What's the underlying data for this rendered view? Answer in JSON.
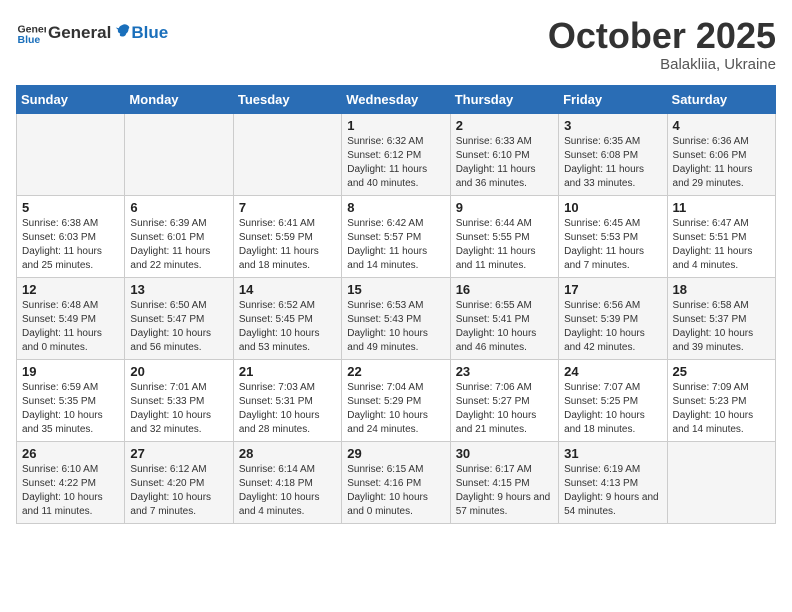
{
  "header": {
    "logo_general": "General",
    "logo_blue": "Blue",
    "month_title": "October 2025",
    "location": "Balakliia, Ukraine"
  },
  "weekdays": [
    "Sunday",
    "Monday",
    "Tuesday",
    "Wednesday",
    "Thursday",
    "Friday",
    "Saturday"
  ],
  "weeks": [
    [
      {
        "day": "",
        "text": ""
      },
      {
        "day": "",
        "text": ""
      },
      {
        "day": "",
        "text": ""
      },
      {
        "day": "1",
        "text": "Sunrise: 6:32 AM\nSunset: 6:12 PM\nDaylight: 11 hours\nand 40 minutes."
      },
      {
        "day": "2",
        "text": "Sunrise: 6:33 AM\nSunset: 6:10 PM\nDaylight: 11 hours\nand 36 minutes."
      },
      {
        "day": "3",
        "text": "Sunrise: 6:35 AM\nSunset: 6:08 PM\nDaylight: 11 hours\nand 33 minutes."
      },
      {
        "day": "4",
        "text": "Sunrise: 6:36 AM\nSunset: 6:06 PM\nDaylight: 11 hours\nand 29 minutes."
      }
    ],
    [
      {
        "day": "5",
        "text": "Sunrise: 6:38 AM\nSunset: 6:03 PM\nDaylight: 11 hours\nand 25 minutes."
      },
      {
        "day": "6",
        "text": "Sunrise: 6:39 AM\nSunset: 6:01 PM\nDaylight: 11 hours\nand 22 minutes."
      },
      {
        "day": "7",
        "text": "Sunrise: 6:41 AM\nSunset: 5:59 PM\nDaylight: 11 hours\nand 18 minutes."
      },
      {
        "day": "8",
        "text": "Sunrise: 6:42 AM\nSunset: 5:57 PM\nDaylight: 11 hours\nand 14 minutes."
      },
      {
        "day": "9",
        "text": "Sunrise: 6:44 AM\nSunset: 5:55 PM\nDaylight: 11 hours\nand 11 minutes."
      },
      {
        "day": "10",
        "text": "Sunrise: 6:45 AM\nSunset: 5:53 PM\nDaylight: 11 hours\nand 7 minutes."
      },
      {
        "day": "11",
        "text": "Sunrise: 6:47 AM\nSunset: 5:51 PM\nDaylight: 11 hours\nand 4 minutes."
      }
    ],
    [
      {
        "day": "12",
        "text": "Sunrise: 6:48 AM\nSunset: 5:49 PM\nDaylight: 11 hours\nand 0 minutes."
      },
      {
        "day": "13",
        "text": "Sunrise: 6:50 AM\nSunset: 5:47 PM\nDaylight: 10 hours\nand 56 minutes."
      },
      {
        "day": "14",
        "text": "Sunrise: 6:52 AM\nSunset: 5:45 PM\nDaylight: 10 hours\nand 53 minutes."
      },
      {
        "day": "15",
        "text": "Sunrise: 6:53 AM\nSunset: 5:43 PM\nDaylight: 10 hours\nand 49 minutes."
      },
      {
        "day": "16",
        "text": "Sunrise: 6:55 AM\nSunset: 5:41 PM\nDaylight: 10 hours\nand 46 minutes."
      },
      {
        "day": "17",
        "text": "Sunrise: 6:56 AM\nSunset: 5:39 PM\nDaylight: 10 hours\nand 42 minutes."
      },
      {
        "day": "18",
        "text": "Sunrise: 6:58 AM\nSunset: 5:37 PM\nDaylight: 10 hours\nand 39 minutes."
      }
    ],
    [
      {
        "day": "19",
        "text": "Sunrise: 6:59 AM\nSunset: 5:35 PM\nDaylight: 10 hours\nand 35 minutes."
      },
      {
        "day": "20",
        "text": "Sunrise: 7:01 AM\nSunset: 5:33 PM\nDaylight: 10 hours\nand 32 minutes."
      },
      {
        "day": "21",
        "text": "Sunrise: 7:03 AM\nSunset: 5:31 PM\nDaylight: 10 hours\nand 28 minutes."
      },
      {
        "day": "22",
        "text": "Sunrise: 7:04 AM\nSunset: 5:29 PM\nDaylight: 10 hours\nand 24 minutes."
      },
      {
        "day": "23",
        "text": "Sunrise: 7:06 AM\nSunset: 5:27 PM\nDaylight: 10 hours\nand 21 minutes."
      },
      {
        "day": "24",
        "text": "Sunrise: 7:07 AM\nSunset: 5:25 PM\nDaylight: 10 hours\nand 18 minutes."
      },
      {
        "day": "25",
        "text": "Sunrise: 7:09 AM\nSunset: 5:23 PM\nDaylight: 10 hours\nand 14 minutes."
      }
    ],
    [
      {
        "day": "26",
        "text": "Sunrise: 6:10 AM\nSunset: 4:22 PM\nDaylight: 10 hours\nand 11 minutes."
      },
      {
        "day": "27",
        "text": "Sunrise: 6:12 AM\nSunset: 4:20 PM\nDaylight: 10 hours\nand 7 minutes."
      },
      {
        "day": "28",
        "text": "Sunrise: 6:14 AM\nSunset: 4:18 PM\nDaylight: 10 hours\nand 4 minutes."
      },
      {
        "day": "29",
        "text": "Sunrise: 6:15 AM\nSunset: 4:16 PM\nDaylight: 10 hours\nand 0 minutes."
      },
      {
        "day": "30",
        "text": "Sunrise: 6:17 AM\nSunset: 4:15 PM\nDaylight: 9 hours\nand 57 minutes."
      },
      {
        "day": "31",
        "text": "Sunrise: 6:19 AM\nSunset: 4:13 PM\nDaylight: 9 hours\nand 54 minutes."
      },
      {
        "day": "",
        "text": ""
      }
    ]
  ]
}
